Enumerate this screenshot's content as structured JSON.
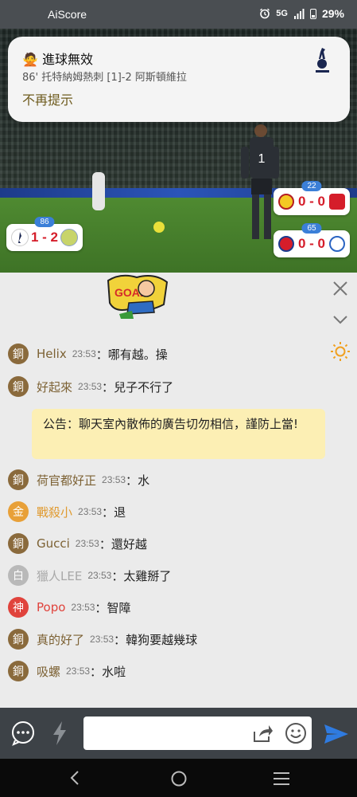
{
  "status_bar": {
    "app_name": "AiScore",
    "network": "5G",
    "battery": "29%"
  },
  "notification": {
    "title": "🙅 進球無效",
    "body": "86' 托特納姆熱刺 [1]-2 阿斯頓維拉",
    "action": "不再提示",
    "team_icon": "tottenham-crest-icon"
  },
  "video": {
    "player_number": "1",
    "main_card": {
      "minute": "86",
      "score": "1 - 2"
    },
    "side_cards": [
      {
        "minute": "22",
        "score": "0 - 0"
      },
      {
        "minute": "65",
        "score": "0 - 0"
      }
    ]
  },
  "chat": {
    "announcement": "公告：聊天室內散佈的廣告切勿相信，謹防上當!",
    "messages": [
      {
        "badge": "銅",
        "badge_color": "#8a6a3c",
        "user": "Helix",
        "user_color": "#7c6133",
        "time": "23:53",
        "text": "哪有越。操"
      },
      {
        "badge": "銅",
        "badge_color": "#8a6a3c",
        "user": "好起來",
        "user_color": "#7c6133",
        "time": "23:53",
        "text": "兒子不行了"
      },
      {
        "badge": "銅",
        "badge_color": "#8a6a3c",
        "user": "荷官都好正",
        "user_color": "#7c6133",
        "time": "23:53",
        "text": "水"
      },
      {
        "badge": "金",
        "badge_color": "#e8a038",
        "user": "戰殺小",
        "user_color": "#e09a2f",
        "time": "23:53",
        "text": "退"
      },
      {
        "badge": "銅",
        "badge_color": "#8a6a3c",
        "user": "Gucci",
        "user_color": "#7c6133",
        "time": "23:53",
        "text": "還好越"
      },
      {
        "badge": "白",
        "badge_color": "#b9b9b9",
        "user": "獵人LEE",
        "user_color": "#a8a8a8",
        "time": "23:53",
        "text": "太雞掰了"
      },
      {
        "badge": "神",
        "badge_color": "#e0433c",
        "user": "Popo",
        "user_color": "#e0433c",
        "time": "23:53",
        "text": "智障"
      },
      {
        "badge": "銅",
        "badge_color": "#8a6a3c",
        "user": "真的好了",
        "user_color": "#7c6133",
        "time": "23:53",
        "text": "韓狗要越幾球"
      },
      {
        "badge": "銅",
        "badge_color": "#8a6a3c",
        "user": "吸螺",
        "user_color": "#7c6133",
        "time": "23:53",
        "text": "水啦"
      }
    ]
  },
  "input": {
    "placeholder": ""
  },
  "colors": {
    "accent_blue": "#3b7fd8",
    "score_red": "#d51d2a",
    "announce_bg": "#fcefb4"
  }
}
